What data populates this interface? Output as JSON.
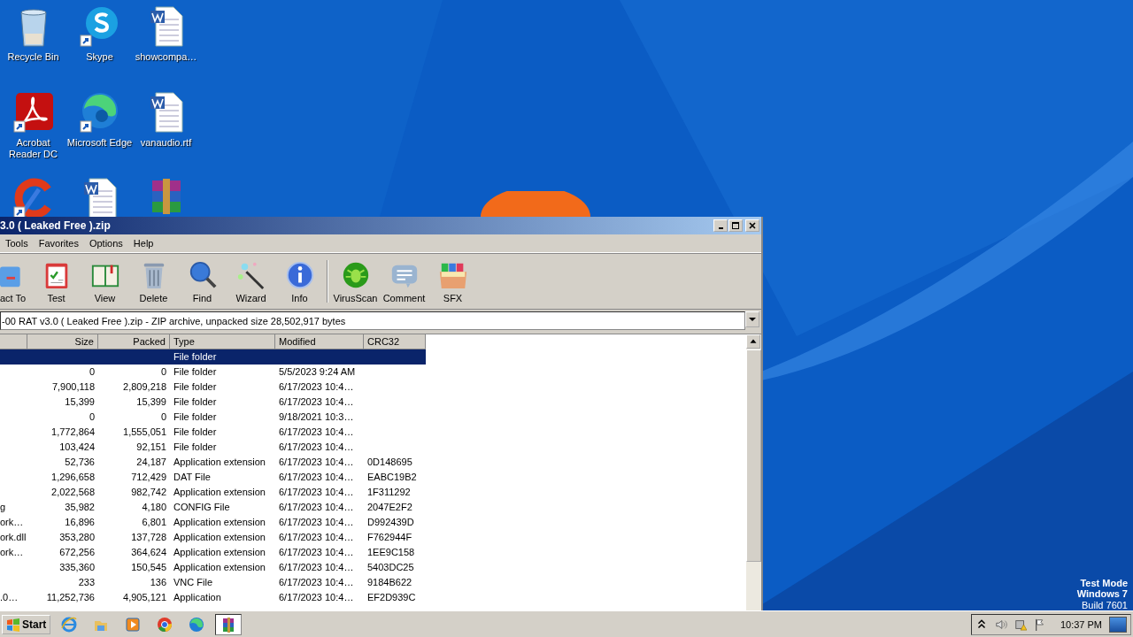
{
  "desktop": {
    "icons": [
      {
        "kind": "recycle",
        "label": "Recycle Bin",
        "shortcut": false
      },
      {
        "kind": "skype",
        "label": "Skype",
        "shortcut": true
      },
      {
        "kind": "word",
        "label": "showcompa…",
        "shortcut": false
      },
      {
        "kind": "acrobat",
        "label": "Acrobat Reader DC",
        "shortcut": true
      },
      {
        "kind": "edge",
        "label": "Microsoft Edge",
        "shortcut": true
      },
      {
        "kind": "word",
        "label": "vanaudio.rtf",
        "shortcut": false
      },
      {
        "kind": "ccleaner",
        "shortcut": true
      },
      {
        "kind": "word",
        "shortcut": false
      },
      {
        "kind": "winrar",
        "shortcut": false
      }
    ],
    "os_notice": [
      "Test Mode",
      "Windows 7",
      "Build 7601"
    ]
  },
  "window": {
    "title": "3.0 ( Leaked Free ).zip",
    "menu": [
      "Tools",
      "Favorites",
      "Options",
      "Help"
    ],
    "toolbar": [
      {
        "kind": "extract",
        "label": "act To"
      },
      {
        "kind": "test",
        "label": "Test"
      },
      {
        "kind": "view",
        "label": "View"
      },
      {
        "kind": "delete",
        "label": "Delete"
      },
      {
        "kind": "find",
        "label": "Find"
      },
      {
        "kind": "wizard",
        "label": "Wizard"
      },
      {
        "kind": "info",
        "label": "Info"
      },
      {
        "kind": "virus",
        "label": "VirusScan"
      },
      {
        "kind": "comment",
        "label": "Comment"
      },
      {
        "kind": "sfx",
        "label": "SFX"
      }
    ],
    "address": {
      "value": "-00 RAT v3.0 ( Leaked Free ).zip - ZIP archive, unpacked size 28,502,917 bytes"
    },
    "columns": [
      "Size",
      "Packed",
      "Type",
      "Modified",
      "CRC32"
    ],
    "rows": [
      {
        "name": "",
        "size": "",
        "packed": "",
        "type": "File folder",
        "modified": "",
        "crc": "",
        "selected": true
      },
      {
        "name": "",
        "size": "0",
        "packed": "0",
        "type": "File folder",
        "modified": "5/5/2023 9:24 AM",
        "crc": "",
        "selected": false
      },
      {
        "name": "",
        "size": "7,900,118",
        "packed": "2,809,218",
        "type": "File folder",
        "modified": "6/17/2023 10:4…",
        "crc": "",
        "selected": false
      },
      {
        "name": "",
        "size": "15,399",
        "packed": "15,399",
        "type": "File folder",
        "modified": "6/17/2023 10:4…",
        "crc": "",
        "selected": false
      },
      {
        "name": "",
        "size": "0",
        "packed": "0",
        "type": "File folder",
        "modified": "9/18/2021 10:3…",
        "crc": "",
        "selected": false
      },
      {
        "name": "",
        "size": "1,772,864",
        "packed": "1,555,051",
        "type": "File folder",
        "modified": "6/17/2023 10:4…",
        "crc": "",
        "selected": false
      },
      {
        "name": "",
        "size": "103,424",
        "packed": "92,151",
        "type": "File folder",
        "modified": "6/17/2023 10:4…",
        "crc": "",
        "selected": false
      },
      {
        "name": "",
        "size": "52,736",
        "packed": "24,187",
        "type": "Application extension",
        "modified": "6/17/2023 10:4…",
        "crc": "0D148695",
        "selected": false
      },
      {
        "name": "",
        "size": "1,296,658",
        "packed": "712,429",
        "type": "DAT File",
        "modified": "6/17/2023 10:4…",
        "crc": "EABC19B2",
        "selected": false
      },
      {
        "name": "",
        "size": "2,022,568",
        "packed": "982,742",
        "type": "Application extension",
        "modified": "6/17/2023 10:4…",
        "crc": "1F311292",
        "selected": false
      },
      {
        "name": "g",
        "size": "35,982",
        "packed": "4,180",
        "type": "CONFIG File",
        "modified": "6/17/2023 10:4…",
        "crc": "2047E2F2",
        "selected": false
      },
      {
        "name": "ork…",
        "size": "16,896",
        "packed": "6,801",
        "type": "Application extension",
        "modified": "6/17/2023 10:4…",
        "crc": "D992439D",
        "selected": false
      },
      {
        "name": "ork.dll",
        "size": "353,280",
        "packed": "137,728",
        "type": "Application extension",
        "modified": "6/17/2023 10:4…",
        "crc": "F762944F",
        "selected": false
      },
      {
        "name": "ork…",
        "size": "672,256",
        "packed": "364,624",
        "type": "Application extension",
        "modified": "6/17/2023 10:4…",
        "crc": "1EE9C158",
        "selected": false
      },
      {
        "name": "",
        "size": "335,360",
        "packed": "150,545",
        "type": "Application extension",
        "modified": "6/17/2023 10:4…",
        "crc": "5403DC25",
        "selected": false
      },
      {
        "name": "",
        "size": "233",
        "packed": "136",
        "type": "VNC File",
        "modified": "6/17/2023 10:4…",
        "crc": "9184B622",
        "selected": false
      },
      {
        "name": ".0…",
        "size": "11,252,736",
        "packed": "4,905,121",
        "type": "Application",
        "modified": "6/17/2023 10:4…",
        "crc": "EF2D939C",
        "selected": false
      }
    ]
  },
  "taskbar": {
    "start": "Start",
    "apps": [
      {
        "kind": "ie",
        "selected": false
      },
      {
        "kind": "explorer",
        "selected": false
      },
      {
        "kind": "media",
        "selected": false
      },
      {
        "kind": "chrome",
        "selected": false
      },
      {
        "kind": "edge",
        "selected": false
      },
      {
        "kind": "winrar",
        "selected": true
      }
    ],
    "clock": "10:37 PM"
  }
}
